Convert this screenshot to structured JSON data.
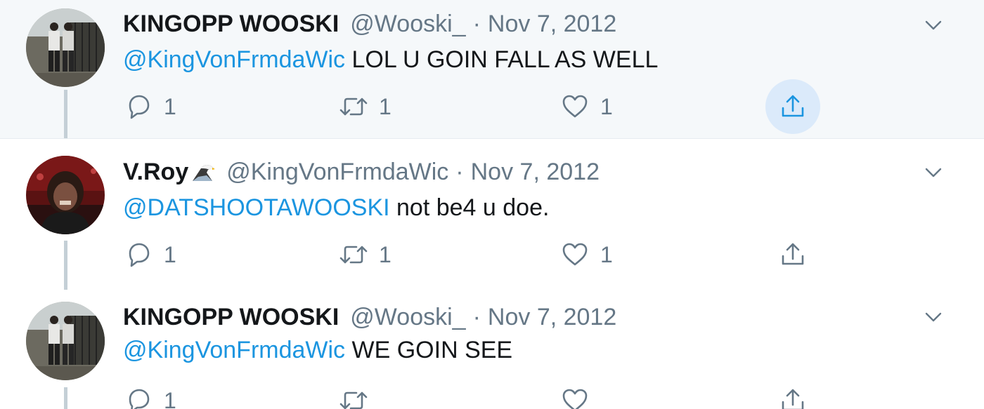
{
  "tweets": [
    {
      "display_name": "KINGOPP WOOSKI",
      "handle": "@Wooski_",
      "separator": "·",
      "date": "Nov 7, 2012",
      "mention": "@KingVonFrmdaWic",
      "text": "LOL U GOIN FALL AS WELL",
      "reply_count": "1",
      "retweet_count": "1",
      "like_count": "1"
    },
    {
      "display_name": "V.Roy",
      "name_emoji": "eagle-emoji-icon",
      "handle": "@KingVonFrmdaWic",
      "separator": "·",
      "date": "Nov 7, 2012",
      "mention": "@DATSHOOTAWOOSKI",
      "text": "not be4 u doe.",
      "reply_count": "1",
      "retweet_count": "1",
      "like_count": "1"
    },
    {
      "display_name": "KINGOPP WOOSKI",
      "handle": "@Wooski_",
      "separator": "·",
      "date": "Nov 7, 2012",
      "mention": "@KingVonFrmdaWic",
      "text": "WE GOIN SEE",
      "reply_count": "1",
      "retweet_count": "",
      "like_count": ""
    }
  ],
  "icons": {
    "reply": "reply-icon",
    "retweet": "retweet-icon",
    "like": "heart-icon",
    "share": "share-icon",
    "more": "chevron-down-icon"
  },
  "colors": {
    "link": "#1b95e0",
    "text": "#14171a",
    "muted": "#657786",
    "highlight_bg": "#f5f8fa",
    "share_active_bg": "#dbeafa",
    "thread_line": "#c4cfd6"
  }
}
